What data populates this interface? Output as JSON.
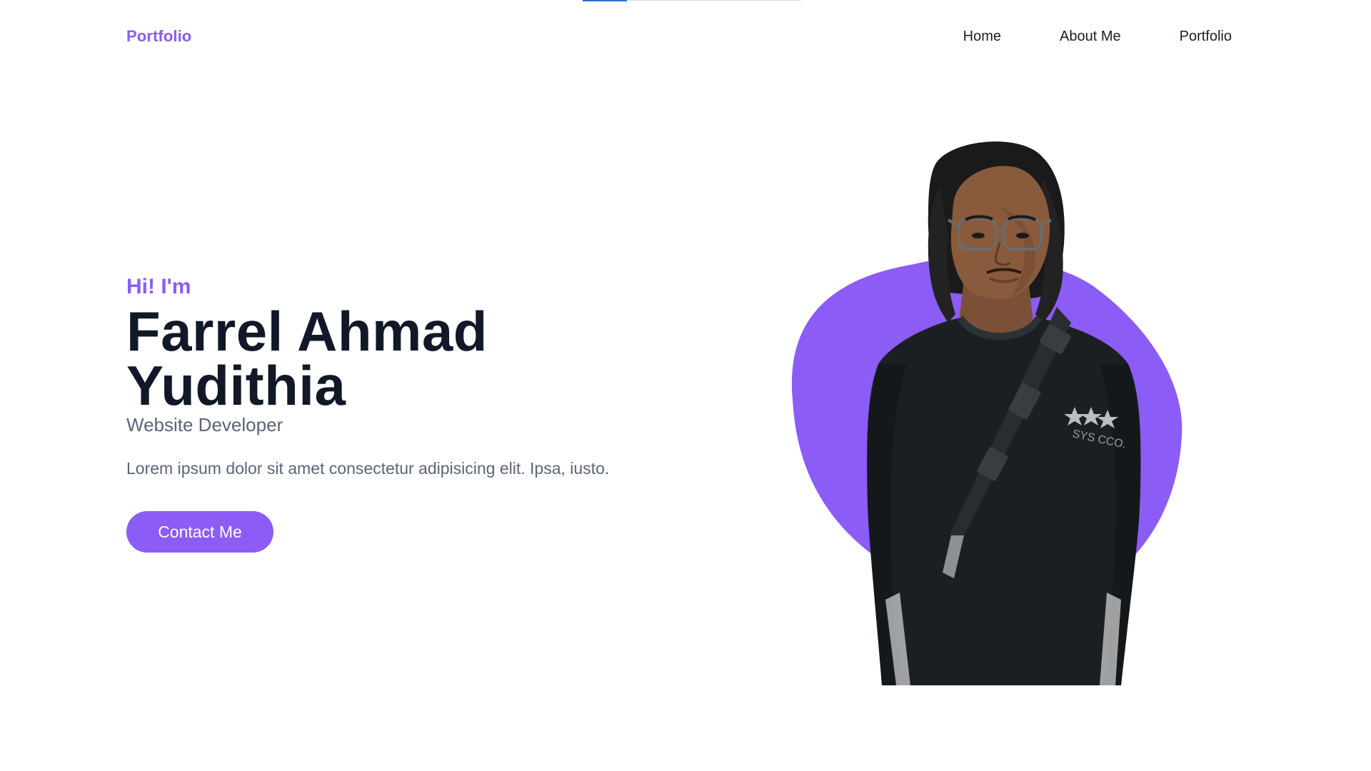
{
  "header": {
    "brand": "Portfolio",
    "nav": [
      {
        "label": "Home"
      },
      {
        "label": "About Me"
      },
      {
        "label": "Portfolio"
      }
    ]
  },
  "hero": {
    "greeting": "Hi! I'm",
    "name_line1": "Farrel Ahmad",
    "name_line2": "Yudithia",
    "role": "Website Developer",
    "description": "Lorem ipsum dolor sit amet consectetur adipisicing elit. Ipsa, iusto.",
    "cta_label": "Contact Me",
    "shirt_print": "SYS CCO."
  },
  "colors": {
    "accent": "#8b5cf6",
    "heading": "#111827",
    "body_text": "#5b6477",
    "nav_text": "#1b1f2a"
  },
  "icons": {
    "portrait": "person-photo"
  }
}
